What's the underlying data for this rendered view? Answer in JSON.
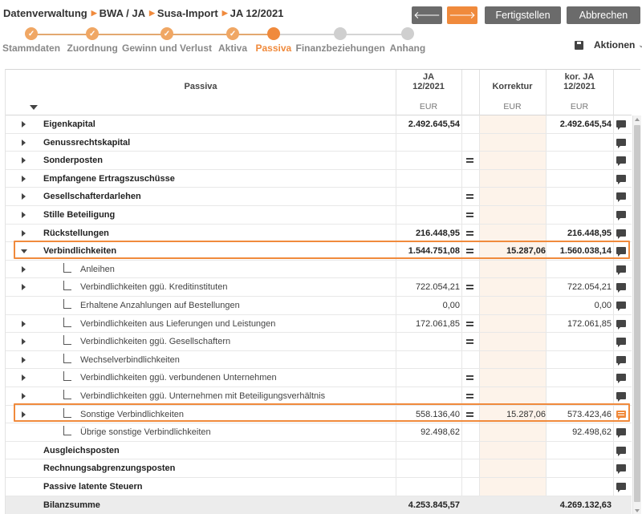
{
  "breadcrumb": [
    "Datenverwaltung",
    "BWA / JA",
    "Susa-Import",
    "JA 12/2021"
  ],
  "buttons": {
    "back": "🡐",
    "forward": "🡒",
    "finish": "Fertigstellen",
    "cancel": "Abbrechen"
  },
  "steps": [
    {
      "label": "Stammdaten",
      "state": "done"
    },
    {
      "label": "Zuordnung",
      "state": "done"
    },
    {
      "label": "Gewinn und Verlust",
      "state": "done"
    },
    {
      "label": "Aktiva",
      "state": "done"
    },
    {
      "label": "Passiva",
      "state": "active"
    },
    {
      "label": "Finanzbeziehungen",
      "state": "todo"
    },
    {
      "label": "Anhang",
      "state": "todo"
    }
  ],
  "actions_label": "Aktionen",
  "table": {
    "headers": {
      "passiva": "Passiva",
      "ja_line1": "JA",
      "ja_line2": "12/2021",
      "korrektur": "Korrektur",
      "korja_line1": "kor. JA",
      "korja_line2": "12/2021",
      "unit_ja": "EUR",
      "unit_kor": "EUR",
      "unit_korja": "EUR"
    },
    "rows": [
      {
        "label": "Eigenkapital",
        "level": 0,
        "caret": "right",
        "bold": true,
        "ja": "2.492.645,54",
        "eq": false,
        "kor": "",
        "korja": "2.492.645,54"
      },
      {
        "label": "Genussrechtskapital",
        "level": 0,
        "caret": "right",
        "bold": true,
        "ja": "",
        "eq": false,
        "kor": "",
        "korja": ""
      },
      {
        "label": "Sonderposten",
        "level": 0,
        "caret": "right",
        "bold": true,
        "ja": "",
        "eq": true,
        "kor": "",
        "korja": ""
      },
      {
        "label": "Empfangene Ertragszuschüsse",
        "level": 0,
        "caret": "right",
        "bold": true,
        "ja": "",
        "eq": false,
        "kor": "",
        "korja": ""
      },
      {
        "label": "Gesellschafterdarlehen",
        "level": 0,
        "caret": "right",
        "bold": true,
        "ja": "",
        "eq": true,
        "kor": "",
        "korja": ""
      },
      {
        "label": "Stille Beteiligung",
        "level": 0,
        "caret": "right",
        "bold": true,
        "ja": "",
        "eq": true,
        "kor": "",
        "korja": ""
      },
      {
        "label": "Rückstellungen",
        "level": 0,
        "caret": "right",
        "bold": true,
        "ja": "216.448,95",
        "eq": true,
        "kor": "",
        "korja": "216.448,95"
      },
      {
        "label": "Verbindlichkeiten",
        "level": 0,
        "caret": "down",
        "bold": true,
        "ja": "1.544.751,08",
        "eq": true,
        "kor": "15.287,06",
        "korja": "1.560.038,14"
      },
      {
        "label": "Anleihen",
        "level": 1,
        "caret": "right",
        "bold": false,
        "ja": "",
        "eq": false,
        "kor": "",
        "korja": ""
      },
      {
        "label": "Verbindlichkeiten ggü. Kreditinstituten",
        "level": 1,
        "caret": "right",
        "bold": false,
        "ja": "722.054,21",
        "eq": true,
        "kor": "",
        "korja": "722.054,21"
      },
      {
        "label": "Erhaltene Anzahlungen auf Bestellungen",
        "level": 1,
        "caret": "none",
        "bold": false,
        "ja": "0,00",
        "eq": false,
        "kor": "",
        "korja": "0,00"
      },
      {
        "label": "Verbindlichkeiten aus Lieferungen und Leistungen",
        "level": 1,
        "caret": "right",
        "bold": false,
        "ja": "172.061,85",
        "eq": true,
        "kor": "",
        "korja": "172.061,85"
      },
      {
        "label": "Verbindlichkeiten ggü. Gesellschaftern",
        "level": 1,
        "caret": "right",
        "bold": false,
        "ja": "",
        "eq": true,
        "kor": "",
        "korja": ""
      },
      {
        "label": "Wechselverbindlichkeiten",
        "level": 1,
        "caret": "right",
        "bold": false,
        "ja": "",
        "eq": false,
        "kor": "",
        "korja": ""
      },
      {
        "label": "Verbindlichkeiten ggü. verbundenen Unternehmen",
        "level": 1,
        "caret": "right",
        "bold": false,
        "ja": "",
        "eq": true,
        "kor": "",
        "korja": ""
      },
      {
        "label": "Verbindlichkeiten ggü. Unternehmen mit Beteiligungsverhältnis",
        "level": 1,
        "caret": "right",
        "bold": false,
        "ja": "",
        "eq": true,
        "kor": "",
        "korja": ""
      },
      {
        "label": "Sonstige Verbindlichkeiten",
        "level": 1,
        "caret": "right",
        "bold": false,
        "ja": "558.136,40",
        "eq": true,
        "kor": "15.287,06",
        "korja": "573.423,46",
        "comment": "orange"
      },
      {
        "label": "Übrige sonstige Verbindlichkeiten",
        "level": 1,
        "caret": "none",
        "bold": false,
        "ja": "92.498,62",
        "eq": false,
        "kor": "",
        "korja": "92.498,62"
      },
      {
        "label": "Ausgleichsposten",
        "level": 0,
        "caret": "none",
        "bold": true,
        "ja": "",
        "eq": false,
        "kor": "",
        "korja": ""
      },
      {
        "label": "Rechnungsabgrenzungsposten",
        "level": 0,
        "caret": "none",
        "bold": true,
        "ja": "",
        "eq": false,
        "kor": "",
        "korja": ""
      },
      {
        "label": "Passive latente Steuern",
        "level": 0,
        "caret": "none",
        "bold": true,
        "ja": "",
        "eq": false,
        "kor": "",
        "korja": ""
      }
    ],
    "sum": {
      "label": "Bilanzsumme",
      "ja": "4.253.845,57",
      "korja": "4.269.132,63"
    }
  },
  "colors": {
    "accent": "#f08a3c",
    "button_grey": "#6b6b6b",
    "korrektur_bg": "#fdf3ea"
  }
}
